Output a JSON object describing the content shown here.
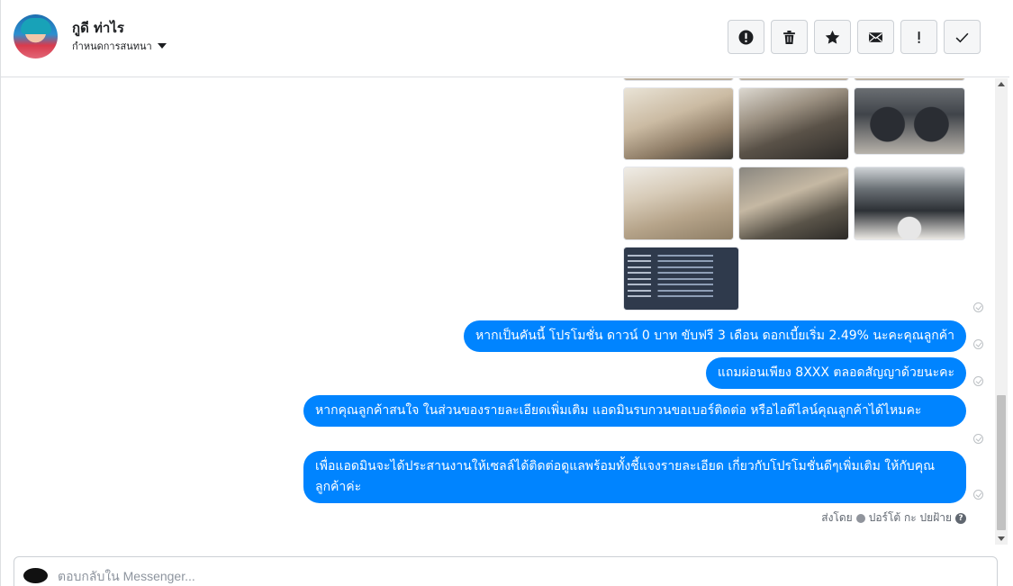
{
  "header": {
    "contact_name": "กูดี ท่าไร",
    "conversation_settings_label": "กำหนดการสนทนา",
    "toolbar": [
      {
        "name": "report-spam-button",
        "icon": "alert-circle-icon"
      },
      {
        "name": "delete-button",
        "icon": "trash-icon"
      },
      {
        "name": "star-button",
        "icon": "star-icon"
      },
      {
        "name": "mark-unread-button",
        "icon": "envelope-icon"
      },
      {
        "name": "flag-important-button",
        "icon": "exclamation-icon"
      },
      {
        "name": "mark-done-button",
        "icon": "checkmark-icon"
      }
    ]
  },
  "messages": [
    {
      "text": "หากเป็นคันนี้ โปรโมชั่น ดาวน์ 0 บาท ขับฟรี 3 เดือน ดอกเบี้ยเริ่ม 2.49% นะคะคุณลูกค้า"
    },
    {
      "text": "แถมผ่อนเพียง 8XXX ตลอดสัญญาด้วยนะคะ"
    },
    {
      "text": "หากคุณลูกค้าสนใจ ในส่วนของรายละเอียดเพิ่มเติม แอดมินรบกวนขอเบอร์ติดต่อ หรือไอดีไลน์คุณลูกค้าได้ไหมคะ"
    },
    {
      "text": "เพื่อแอดมินจะได้ประสานงานให้เซลล์ได้ติดต่อดูแลพร้อมทั้งชี้แจงรายละเอียด เกี่ยวกับโปรโมชั่นดีๆเพิ่มเติม ให้กับคุณลูกค้าค่ะ"
    }
  ],
  "sent_by": {
    "label": "ส่งโดย",
    "name": "ปอร์โต้ กะ ปยฝ้าย",
    "help_icon": "question-circle-icon"
  },
  "composer": {
    "placeholder": "ตอบกลับใน Messenger..."
  },
  "colors": {
    "bubble": "#0084ff",
    "border": "#dddfe2"
  }
}
